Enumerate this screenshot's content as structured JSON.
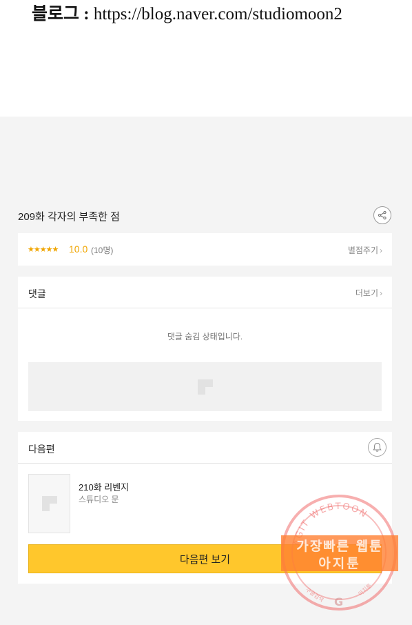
{
  "banner": {
    "blog_label": "블로그 :",
    "blog_url": "https://blog.naver.com/studiomoon2"
  },
  "episode": {
    "title": "209화 각자의 부족한 점"
  },
  "rating": {
    "stars": "★★★★★",
    "score": "10.0",
    "count": "(10명)",
    "rate_link": "별점주기"
  },
  "comments": {
    "title": "댓글",
    "more": "더보기",
    "hidden_message": "댓글 숨김 상태입니다."
  },
  "next_episode": {
    "section_title": "다음편",
    "title": "210화 리벤지",
    "author": "스튜디오 문",
    "button_label": "다음편 보기"
  },
  "watermark": {
    "arc_text": "AGIT WEBTOON",
    "line1": "가장빠른 웹툰",
    "line2": "아지툰",
    "bottom_left": "구글검색",
    "bottom_right": "아지툰",
    "badge_color": "#ff8032",
    "ring_color": "#f08080"
  },
  "theme": {
    "accent_yellow": "#ffc72c",
    "star_color": "#f0a500"
  }
}
